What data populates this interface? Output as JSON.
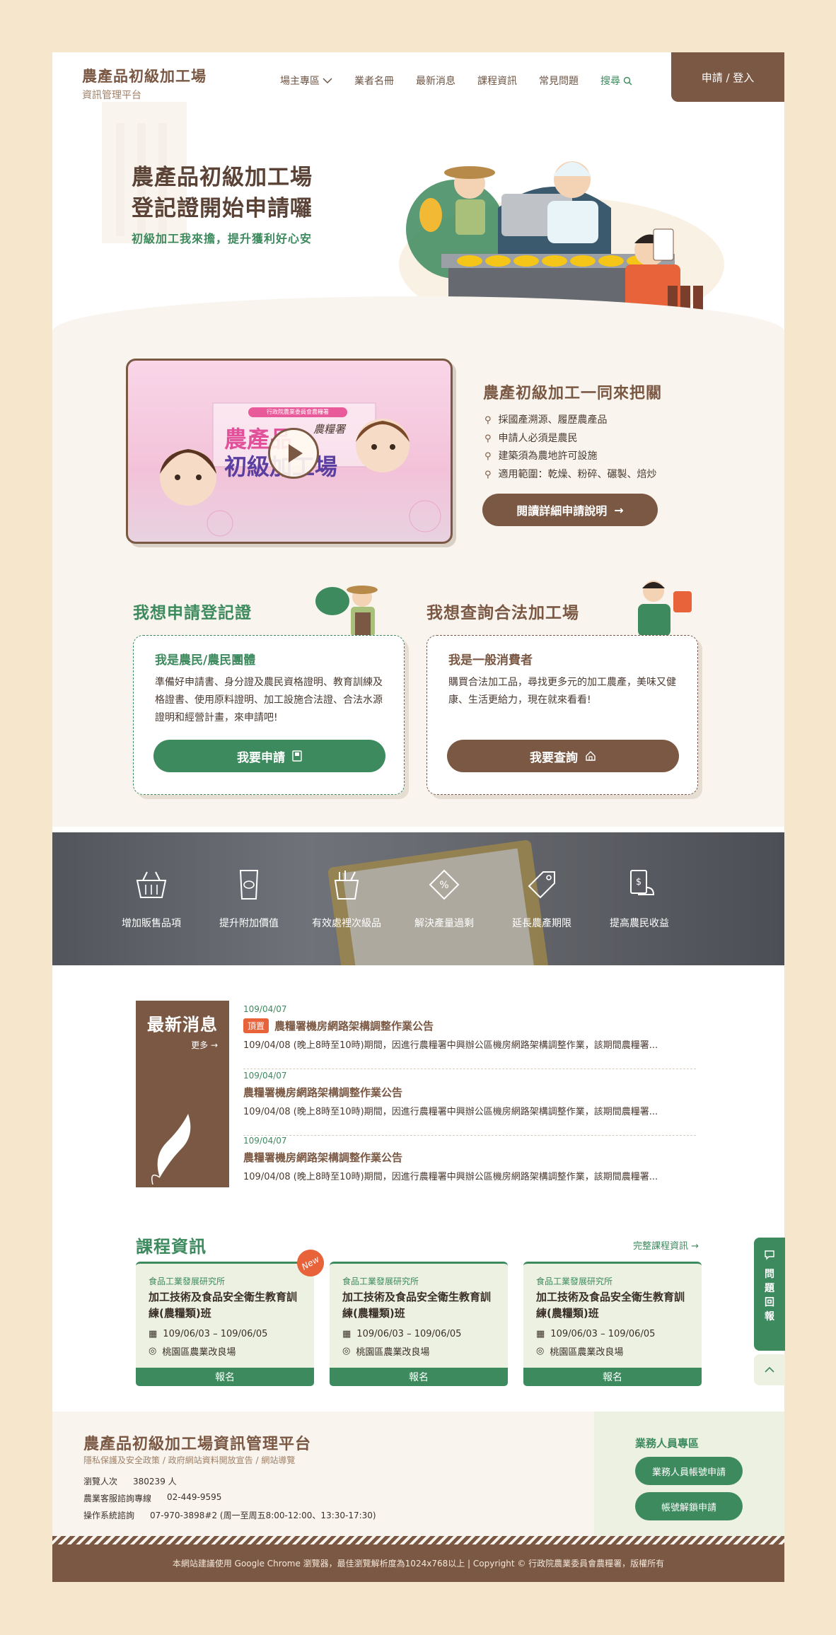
{
  "header": {
    "logo_title": "農產品初級加工場",
    "logo_sub": "資訊管理平台",
    "nav": [
      {
        "label": "場主專區"
      },
      {
        "label": "業者名冊"
      },
      {
        "label": "最新消息"
      },
      {
        "label": "課程資訊"
      },
      {
        "label": "常見問題"
      },
      {
        "label": "搜尋"
      }
    ],
    "login": "申請 / 登入"
  },
  "hero": {
    "title_line1": "農產品初級加工場",
    "title_line2": "登記證開始申請囉",
    "subtitle": "初級加工我來擔，提升獲利好心安"
  },
  "video": {
    "banner_top": "行政院農業委員會農糧署",
    "banner_main_1": "農產品",
    "banner_main_2": "初級加工場",
    "signature": "農糧署"
  },
  "info": {
    "title": "農產初級加工一同來把關",
    "items": [
      "採國產溯源、履歷農產品",
      "申請人必須是農民",
      "建築須為農地許可設施",
      "適用範圍：乾燥、粉碎、碾製、焙炒"
    ],
    "button": "閱讀詳細申請說明"
  },
  "apply_card": {
    "heading": "我想申請登記證",
    "subtitle": "我是農民/農民團體",
    "text": "準備好申請書、身分證及農民資格證明、教育訓練及格證書、使用原料證明、加工設施合法證、合法水源證明和經營計畫，來申請吧!",
    "button": "我要申請"
  },
  "query_card": {
    "heading": "我想查詢合法加工場",
    "subtitle": "我是一般消費者",
    "text": "購買合法加工品，尋找更多元的加工農產，美味又健康、生活更給力，現在就來看看!",
    "button": "我要查詢"
  },
  "benefits": [
    {
      "label": "增加販售品項",
      "icon": "basket-icon"
    },
    {
      "label": "提升附加價值",
      "icon": "package-icon"
    },
    {
      "label": "有效處裡次級品",
      "icon": "bucket-icon"
    },
    {
      "label": "解決產量過剩",
      "icon": "discount-tag-icon"
    },
    {
      "label": "延長農產期限",
      "icon": "price-tag-icon"
    },
    {
      "label": "提高農民收益",
      "icon": "money-hand-icon"
    }
  ],
  "news": {
    "title": "最新消息",
    "more": "更多",
    "items": [
      {
        "date": "109/04/07",
        "tag": "頂置",
        "title": "農糧署機房網路架構調整作業公告",
        "desc": "109/04/08 (晚上8時至10時)期間，因進行農糧署中興辦公區機房網路架構調整作業，該期間農糧署..."
      },
      {
        "date": "109/04/07",
        "tag": "",
        "title": "農糧署機房網路架構調整作業公告",
        "desc": "109/04/08 (晚上8時至10時)期間，因進行農糧署中興辦公區機房網路架構調整作業，該期間農糧署..."
      },
      {
        "date": "109/04/07",
        "tag": "",
        "title": "農糧署機房網路架構調整作業公告",
        "desc": "109/04/08 (晚上8時至10時)期間，因進行農糧署中興辦公區機房網路架構調整作業，該期間農糧署..."
      }
    ]
  },
  "courses": {
    "title": "課程資訊",
    "more": "完整課程資訊",
    "items": [
      {
        "org": "食品工業發展研究所",
        "name": "加工技術及食品安全衛生教育訓練(農糧類)班",
        "date": "109/06/03 – 109/06/05",
        "place": "桃園區農業改良場",
        "button": "報名",
        "badge": "New"
      },
      {
        "org": "食品工業發展研究所",
        "name": "加工技術及食品安全衛生教育訓練(農糧類)班",
        "date": "109/06/03 – 109/06/05",
        "place": "桃園區農業改良場",
        "button": "報名",
        "badge": ""
      },
      {
        "org": "食品工業發展研究所",
        "name": "加工技術及食品安全衛生教育訓練(農糧類)班",
        "date": "109/06/03 – 109/06/05",
        "place": "桃園區農業改良場",
        "button": "報名",
        "badge": ""
      }
    ]
  },
  "float": {
    "report_chars": [
      "問",
      "題",
      "回",
      "報"
    ]
  },
  "footer": {
    "title": "農產品初級加工場資訊管理平台",
    "links": "隱私保護及安全政策 / 政府網站資料開放宣告 / 網站導覽",
    "visitors_label": "瀏覽人次",
    "visitors_value": "380239 人",
    "hotline_label": "農業客服諮詢專線",
    "hotline_value": "02-449-9595",
    "support_label": "操作系統諮詢",
    "support_value": "07-970-3898#2 (周一至周五8:00-12:00、13:30-17:30)",
    "staff_title": "業務人員專區",
    "staff_buttons": [
      "業務人員帳號申請",
      "帳號解鎖申請"
    ],
    "copyright": "本網站建議使用 Google Chrome 瀏覽器，最佳瀏覽解析度為1024x768以上 | Copyright © 行政院農業委員會農糧署，版權所有"
  },
  "colors": {
    "brown": "#7a5843",
    "green": "#3d8a5e",
    "cream": "#f6e6cc",
    "accent_orange": "#e8623a"
  }
}
